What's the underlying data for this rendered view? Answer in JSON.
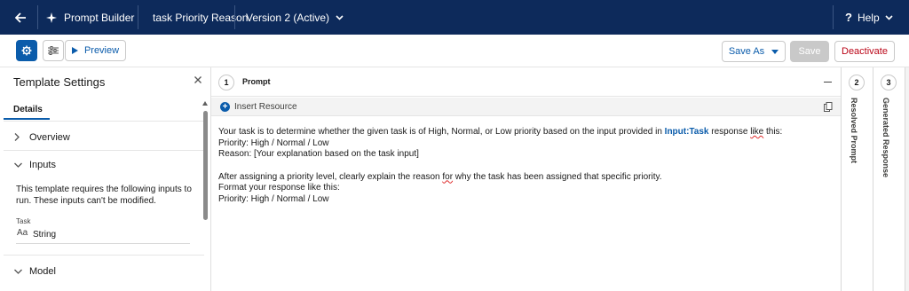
{
  "nav": {
    "app_name": "Prompt Builder",
    "template_name": "task Priority Reason",
    "version_label": "Version 2 (Active)",
    "help_label": "Help"
  },
  "toolbar": {
    "preview_label": "Preview",
    "save_as_label": "Save As",
    "save_label": "Save",
    "deactivate_label": "Deactivate"
  },
  "settings": {
    "title": "Template Settings",
    "tab_details": "Details",
    "overview_label": "Overview",
    "inputs_label": "Inputs",
    "inputs_description": "This template requires the following inputs to run. These inputs can't be modified.",
    "input_name": "Task",
    "input_type_icon": "Aa",
    "input_type": "String",
    "model_label": "Model"
  },
  "prompt": {
    "step_number": "1",
    "title": "Prompt",
    "insert_resource_label": "Insert Resource",
    "line1_before": "Your task is to determine whether the given task is of High, Normal, or Low priority based on the input provided in ",
    "line1_ref": "Input:Task",
    "line1_mid": " response ",
    "line1_squiggle": "like",
    "line1_after": " this:",
    "line2": "Priority: High / Normal / Low",
    "line3": "Reason: [Your explanation based on the task input]",
    "line4_before": "After assigning a priority level, clearly explain the reason ",
    "line4_squiggle": "for",
    "line4_after": " why the task has been assigned that specific priority.",
    "line5": "Format your response like this:",
    "line6": "Priority: High / Normal / Low"
  },
  "rails": {
    "resolved_number": "2",
    "resolved_label": "Resolved Prompt",
    "generated_number": "3",
    "generated_label": "Generated Response"
  },
  "colors": {
    "nav_bg": "#0d2a5b",
    "brand_blue": "#0b5cab",
    "destructive": "#ba0517"
  }
}
